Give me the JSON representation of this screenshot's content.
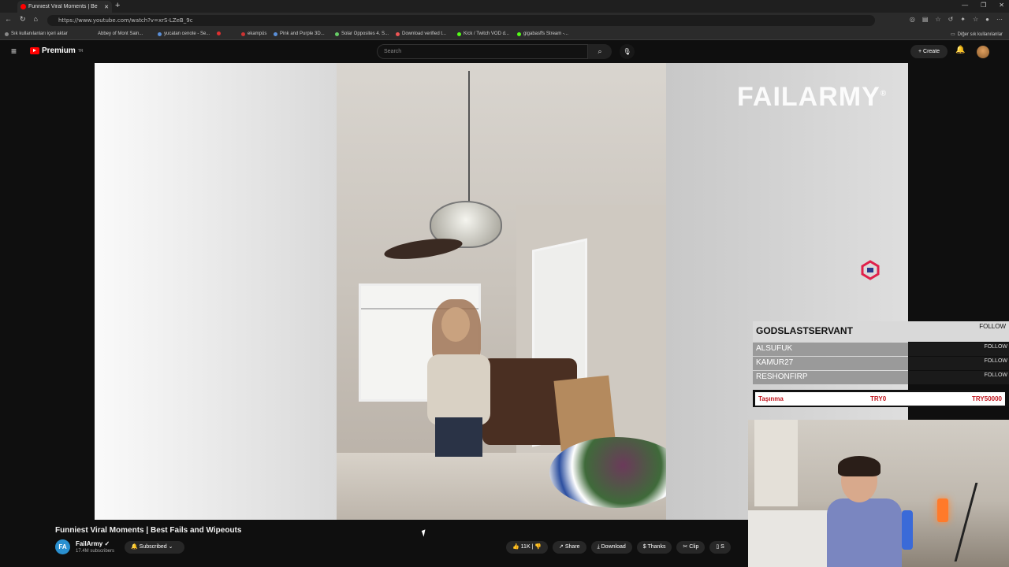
{
  "browser": {
    "tab_title": "Funniest Viral Moments | Be",
    "url": "https://www.youtube.com/watch?v=xrS-LZeB_9c",
    "bookmarks": [
      "Sık kullanılanları içeri aktar",
      "Abbey of Mont Sain...",
      "yucatan cenote - Se...",
      "ekampüs",
      "Pink and Purple 3D...",
      "Solar Opposites 4. S...",
      "Download verified t...",
      "Kick / Twitch VOD d...",
      "gigabasffs Stream -..."
    ],
    "other_bookmarks": "Diğer sık kullanılanlar"
  },
  "youtube": {
    "logo_text": "Premium",
    "logo_sup": "TR",
    "search_placeholder": "Search",
    "create_label": "Create"
  },
  "video": {
    "watermark": "FAILARMY",
    "title": "Funniest Viral Moments | Best Fails and Wipeouts",
    "channel": "FailArmy",
    "subscribers": "17.4M subscribers",
    "subscribe_label": "Subscribed",
    "likes": "11K",
    "share_label": "Share",
    "download_label": "Download",
    "thanks_label": "Thanks",
    "clip_label": "Clip",
    "save_label": "S"
  },
  "overlay": {
    "top_name": "GODSLASTSERVANT",
    "follow": "FOLLOW",
    "rows": [
      "ALSUFUK",
      "KAMUR27",
      "RESHONFIRP"
    ],
    "goal": {
      "label": "Taşınma",
      "current": "TRY0",
      "target": "TRY50000"
    }
  },
  "colors": {
    "brand_red": "#ff0000",
    "goal_red": "#c0141c"
  }
}
